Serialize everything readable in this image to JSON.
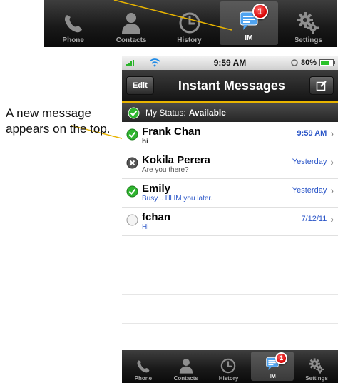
{
  "top_tabbar": {
    "tabs": [
      {
        "label": "Phone",
        "icon": "phone-icon"
      },
      {
        "label": "Contacts",
        "icon": "contacts-icon"
      },
      {
        "label": "History",
        "icon": "clock-icon"
      },
      {
        "label": "IM",
        "icon": "chat-icon",
        "badge": "1"
      },
      {
        "label": "Settings",
        "icon": "gear-icon"
      }
    ],
    "active": "IM"
  },
  "callout": {
    "text": "A new message appears on the top."
  },
  "status_bar": {
    "time": "9:59 AM",
    "battery": "80%"
  },
  "nav": {
    "edit_label": "Edit",
    "title": "Instant Messages",
    "compose_icon": "compose-icon"
  },
  "my_status": {
    "label": "My Status:",
    "value": "Available"
  },
  "conversations": [
    {
      "name": "Frank Chan",
      "message": "hi",
      "time": "9:59 AM",
      "status": "available",
      "msg_color": "#333333"
    },
    {
      "name": "Kokila Perera",
      "message": "Are you there?",
      "time": "Yesterday",
      "status": "busy",
      "msg_color": "#555555"
    },
    {
      "name": "Emily",
      "message": "Busy... I'll IM you later.",
      "time": "Yesterday",
      "status": "available",
      "msg_color": "#2b56c8"
    },
    {
      "name": "fchan",
      "message": "Hi",
      "time": "7/12/11",
      "status": "offline",
      "msg_color": "#2b56c8"
    }
  ],
  "bottom_tabbar": {
    "tabs": [
      {
        "label": "Phone",
        "icon": "phone-icon"
      },
      {
        "label": "Contacts",
        "icon": "contacts-icon"
      },
      {
        "label": "History",
        "icon": "clock-icon"
      },
      {
        "label": "IM",
        "icon": "chat-icon",
        "badge": "1"
      },
      {
        "label": "Settings",
        "icon": "gear-icon"
      }
    ],
    "active": "IM"
  },
  "colors": {
    "accent_gold": "#e8b400",
    "link_blue": "#2b56c8",
    "badge_red": "#d40000",
    "available_green": "#2fb52f"
  }
}
